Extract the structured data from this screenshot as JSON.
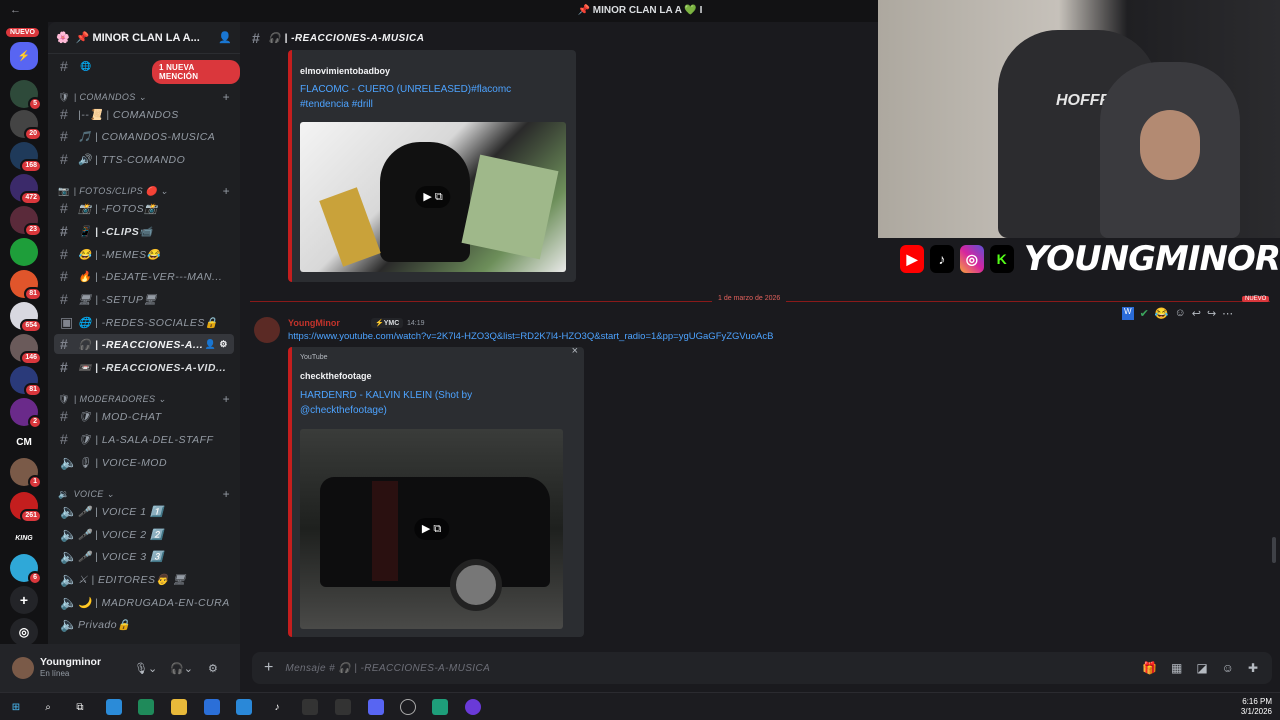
{
  "window": {
    "title": "📌 MINOR CLAN LA A 💚 I",
    "back_icon": "arrow-left-icon"
  },
  "guild_bar": {
    "new_label": "NUEVO",
    "badges": [
      "5",
      "20",
      "168",
      "472",
      "23",
      "81",
      "654",
      "146",
      "81",
      "2",
      "1",
      "261",
      "6"
    ],
    "dm_label": "CM",
    "nitro_label": "KING"
  },
  "server": {
    "name": "📌 MINOR CLAN LA A...",
    "mention_banner": "1 NUEVA MENCIÓN"
  },
  "categories": {
    "comandos": "| COMANDOS ⌄",
    "fotos": "| FOTOS/CLIPS 🔴 ⌄",
    "moderadores": "| MODERADORES ⌄",
    "voice": "VOICE ⌄"
  },
  "channels": [
    {
      "label": "|--📜 | COMANDOS"
    },
    {
      "label": "🎵 | COMANDOS-MUSICA"
    },
    {
      "label": "🔊 | TTS-COMANDO"
    },
    {
      "label": "📸 | -FOTOS📸"
    },
    {
      "label": "📱 | -CLIPS📹"
    },
    {
      "label": "😂 | -MEMES😂"
    },
    {
      "label": "🔥 | -DEJATE-VER---MAN..."
    },
    {
      "label": "🖥 | -SETUP🖥"
    },
    {
      "label": "🌐 | -REDES-SOCIALES🔒"
    },
    {
      "label": "🎧 | -REACCIONES-A..."
    },
    {
      "label": "📼 | -REACCIONES-A-VID..."
    },
    {
      "label": "🛡 | MOD-CHAT"
    },
    {
      "label": "🛡 | LA-SALA-DEL-STAFF"
    },
    {
      "label": "🎙 | VOICE-MOD"
    },
    {
      "label": "🎤 | VOICE 1 1️⃣"
    },
    {
      "label": "🎤 | VOICE 2 2️⃣"
    },
    {
      "label": "🎤 | VOICE 3 3️⃣"
    },
    {
      "label": "⚔ | EDITORES👨 🖥"
    },
    {
      "label": "🌙 | MADRUGADA-EN-CURA"
    },
    {
      "label": "Privado🔒"
    }
  ],
  "user": {
    "name": "Youngminor",
    "status": "En línea"
  },
  "channel_header": "🎧 | -REACCIONES-A-MUSICA",
  "embed1": {
    "author": "elmovimientobadboy",
    "title": "FLACOMC - CUERO (UNRELEASED)#flacomc #tendencia #drill"
  },
  "divider_date": "1 de marzo de 2026",
  "divider_new": "NUEVO",
  "message": {
    "author": "YoungMinor",
    "tag": "⚡YMC",
    "time": "14:19",
    "link": "https://www.youtube.com/watch?v=2K7l4-HZO3Q&list=RD2K7l4-HZO3Q&start_radio=1&pp=ygUGaGFyZGVuoAcB"
  },
  "embed2": {
    "provider": "YouTube",
    "author": "checkthefootage",
    "title": "HARDENRD - KALVIN KLEIN (Shot by @checkthefootage)"
  },
  "composer": {
    "placeholder": "Mensaje # 🎧 | -REACCIONES-A-MUSICA"
  },
  "overlay": {
    "brand": "YOUNGMINOR"
  },
  "webcam_text": "HOFFREE",
  "clock": {
    "time": "6:16 PM",
    "date": "3/1/2026"
  }
}
